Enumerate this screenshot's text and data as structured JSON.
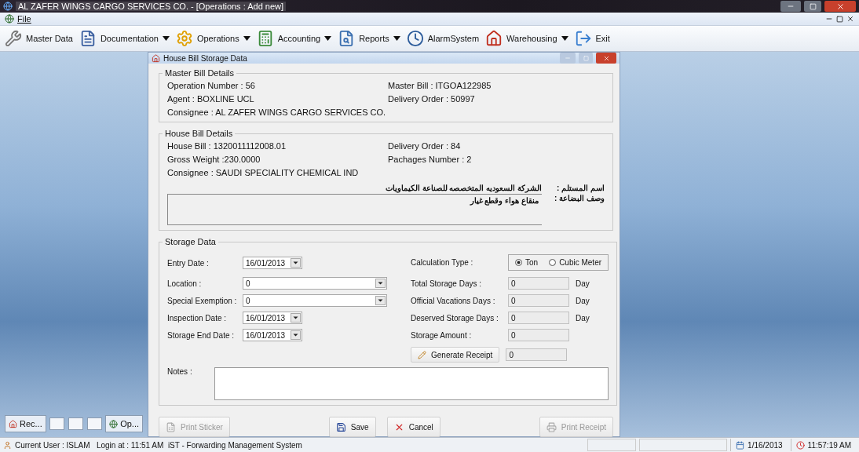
{
  "app_title": "AL ZAFER WINGS CARGO SERVICES CO. - [Operations : Add new]",
  "menu": [
    {
      "label": "File"
    }
  ],
  "toolbar": [
    {
      "label": "Master Data",
      "dropdown": false
    },
    {
      "label": "Documentation",
      "dropdown": true
    },
    {
      "label": "Operations",
      "dropdown": true
    },
    {
      "label": "Accounting",
      "dropdown": true
    },
    {
      "label": "Reports",
      "dropdown": true
    },
    {
      "label": "AlarmSystem",
      "dropdown": false
    },
    {
      "label": "Warehousing",
      "dropdown": true
    },
    {
      "label": "Exit",
      "dropdown": false
    }
  ],
  "minimized": [
    {
      "label": "Rec..."
    },
    {
      "label": "Op..."
    }
  ],
  "form": {
    "title": "House Bill Storage Data",
    "master_bill": {
      "legend": "Master Bill Details",
      "rows": [
        [
          "Operation Number : 56",
          "Master Bill : ITGOA122985"
        ],
        [
          "Agent : BOXLINE UCL",
          "Delivery Order : 50997"
        ],
        [
          "Consignee : AL ZAFER WINGS CARGO SERVICES CO."
        ]
      ]
    },
    "house_bill": {
      "legend": "House Bill Details",
      "rows": [
        [
          "House Bill : 1320011112008.01",
          "Delivery Order : 84"
        ],
        [
          "Gross Weight :230.0000",
          "Pachages Number : 2"
        ],
        [
          "Consignee : SAUDI SPECIALITY CHEMICAL IND"
        ]
      ],
      "consignee_ar": {
        "label": "اسم المستلم :",
        "value": "الشركة السعوديه المتخصصه للصناعة الكيماويات"
      },
      "goods_ar": {
        "label": "وصف البضاعة :",
        "value": "منقاع هواء وقطع غيار"
      }
    },
    "storage": {
      "legend": "Storage Data",
      "left": [
        {
          "label": "Entry Date :",
          "value": "16/01/2013",
          "kind": "date"
        },
        {
          "label": "Location :",
          "value": "0",
          "kind": "combo"
        },
        {
          "label": "Special Exemption :",
          "value": "0",
          "kind": "combo"
        },
        {
          "label": "Inspection Date :",
          "value": "16/01/2013",
          "kind": "date"
        },
        {
          "label": "Storage End Date :",
          "value": "16/01/2013",
          "kind": "date"
        }
      ],
      "calc_label": "Calculation Type :",
      "calc_options": [
        {
          "label": "Ton",
          "selected": true
        },
        {
          "label": "Cubic Meter",
          "selected": false
        }
      ],
      "right": [
        {
          "label": "Total Storage Days :",
          "value": "0",
          "unit": "Day"
        },
        {
          "label": "Official Vacations Days :",
          "value": "0",
          "unit": "Day"
        },
        {
          "label": "Deserved Storage Days :",
          "value": "0",
          "unit": "Day"
        },
        {
          "label": "Storage Amount :",
          "value": "0"
        }
      ],
      "generate": {
        "label": "Generate Receipt",
        "value": "0"
      },
      "notes_label": "Notes :"
    },
    "buttons": [
      {
        "label": "Print Sticker",
        "disabled": true
      },
      {
        "label": "Save",
        "disabled": false
      },
      {
        "label": "Cancel",
        "disabled": false
      },
      {
        "label": "Print Receipt",
        "disabled": true
      }
    ]
  },
  "status": {
    "text": "Current User : ISLAM   Login at : 11:51 AM  iST - Forwarding Management System",
    "date": "1/16/2013",
    "time": "11:57:19 AM"
  }
}
